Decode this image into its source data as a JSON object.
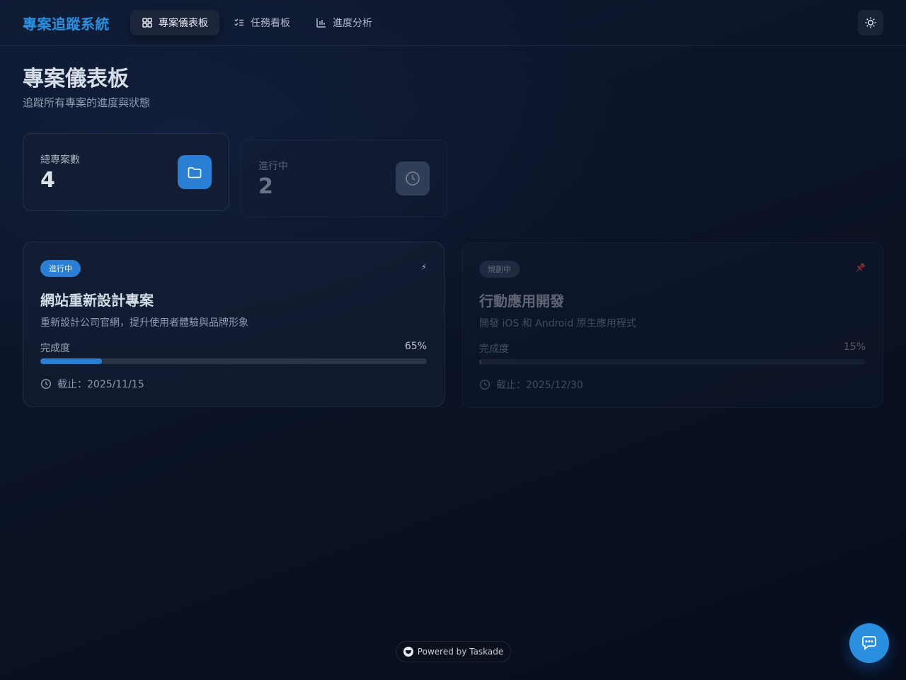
{
  "header": {
    "brand": "專案追蹤系統",
    "nav": [
      {
        "label": "專案儀表板",
        "active": true,
        "icon": "grid-icon"
      },
      {
        "label": "任務看板",
        "active": false,
        "icon": "list-check-icon"
      },
      {
        "label": "進度分析",
        "active": false,
        "icon": "bar-chart-icon"
      }
    ],
    "theme_icon": "sun-icon"
  },
  "page": {
    "title": "專案儀表板",
    "subtitle": "追蹤所有專案的進度與狀態"
  },
  "stats": [
    {
      "label": "總專案數",
      "value": "4",
      "icon": "folder-icon",
      "color": "#2a7fd4"
    },
    {
      "label": "進行中",
      "value": "2",
      "icon": "clock-icon",
      "color": "#5b6b88"
    }
  ],
  "projects": [
    {
      "status": "進行中",
      "corner_icon": "lightning-icon",
      "corner_glyph": "⚡",
      "name": "網站重新設計專案",
      "description": "重新設計公司官網，提升使用者體驗與品牌形象",
      "progress_label": "完成度",
      "progress_text": "65%",
      "progress_fill": 0.16,
      "deadline": "截止：2025/11/15"
    },
    {
      "status": "規劃中",
      "corner_icon": "pin-icon",
      "corner_glyph": "📌",
      "name": "行動應用開發",
      "description": "開發 iOS 和 Android 原生應用程式",
      "progress_label": "完成度",
      "progress_text": "15%",
      "progress_fill": 0.005,
      "deadline": "截止：2025/12/30"
    }
  ],
  "footer": {
    "powered": "Powered by Taskade"
  },
  "colors": {
    "accent": "#2a8fe0",
    "background": "#0b1224"
  }
}
